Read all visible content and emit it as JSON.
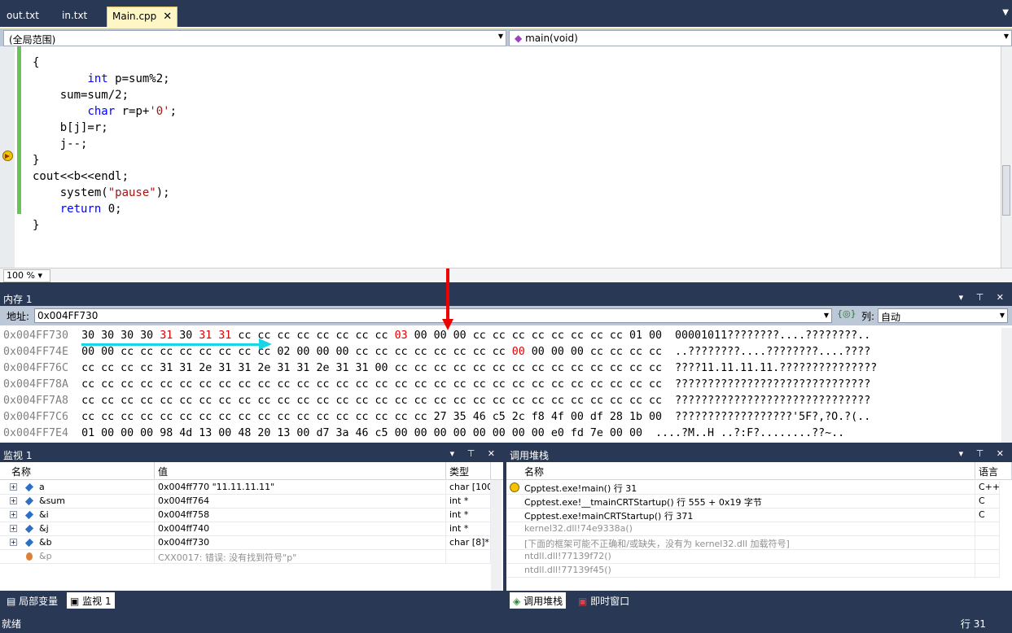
{
  "tabs": [
    {
      "label": "out.txt",
      "active": false
    },
    {
      "label": "in.txt",
      "active": false
    },
    {
      "label": "Main.cpp",
      "active": true
    }
  ],
  "nav": {
    "scope": "(全局范围)",
    "function": "main(void)"
  },
  "code": [
    "{",
    "    int p=sum%2;",
    "    sum=sum/2;",
    "    char r=p+'0';",
    "    b[j]=r;",
    "    j--;",
    "}",
    "cout<<b<<endl;",
    "system(\"pause\");",
    "return 0;",
    "}"
  ],
  "zoom": "100 %",
  "memory": {
    "title": "内存 1",
    "addr_label": "地址:",
    "address": "0x004FF730",
    "col_label": "列:",
    "col_value": "自动",
    "rows": [
      {
        "addr": "0x004FF730",
        "hex": "30 30 30 30 31 30 31 31 cc cc cc cc cc cc cc cc 03 00 00 00 cc cc cc cc cc cc cc cc 01 00",
        "ascii": "00001011????????....????????.."
      },
      {
        "addr": "0x004FF74E",
        "hex": "00 00 cc cc cc cc cc cc cc cc 02 00 00 00 cc cc cc cc cc cc cc cc 00 00 00 00 cc cc cc cc",
        "ascii": "..????????....????????....????"
      },
      {
        "addr": "0x004FF76C",
        "hex": "cc cc cc cc 31 31 2e 31 31 2e 31 31 2e 31 31 00 cc cc cc cc cc cc cc cc cc cc cc cc cc cc",
        "ascii": "????11.11.11.11.???????????????"
      },
      {
        "addr": "0x004FF78A",
        "hex": "cc cc cc cc cc cc cc cc cc cc cc cc cc cc cc cc cc cc cc cc cc cc cc cc cc cc cc cc cc cc",
        "ascii": "??????????????????????????????"
      },
      {
        "addr": "0x004FF7A8",
        "hex": "cc cc cc cc cc cc cc cc cc cc cc cc cc cc cc cc cc cc cc cc cc cc cc cc cc cc cc cc cc cc",
        "ascii": "??????????????????????????????"
      },
      {
        "addr": "0x004FF7C6",
        "hex": "cc cc cc cc cc cc cc cc cc cc cc cc cc cc cc cc cc cc 27 35 46 c5 2c f8 4f 00 df 28 1b 00",
        "ascii": "??????????????????'5F?,?O.?(.."
      },
      {
        "addr": "0x004FF7E4",
        "hex": "01 00 00 00 98 4d 13 00 48 20 13 00 d7 3a 46 c5 00 00 00 00 00 00 00 00 e0 fd 7e 00 00",
        "ascii": "....?M..H ..?:F?........??~.."
      }
    ]
  },
  "watch": {
    "title": "监视 1",
    "headers": [
      "名称",
      "值",
      "类型"
    ],
    "rows": [
      {
        "name": "a",
        "value": "0x004ff770 \"11.11.11.11\"",
        "type": "char [100"
      },
      {
        "name": "&sum",
        "value": "0x004ff764",
        "type": "int *"
      },
      {
        "name": "&i",
        "value": "0x004ff758",
        "type": "int *"
      },
      {
        "name": "&j",
        "value": "0x004ff740",
        "type": "int *"
      },
      {
        "name": "&b",
        "value": "0x004ff730",
        "type": "char [8]*"
      },
      {
        "name": "&p",
        "value": "CXX0017: 错误: 没有找到符号\"p\"",
        "type": ""
      }
    ]
  },
  "callstack": {
    "title": "调用堆栈",
    "headers": [
      "名称",
      "语言"
    ],
    "rows": [
      {
        "name": "Cpptest.exe!main()  行 31",
        "lang": "C++"
      },
      {
        "name": "Cpptest.exe!__tmainCRTStartup()  行 555 + 0x19 字节",
        "lang": "C"
      },
      {
        "name": "Cpptest.exe!mainCRTStartup()  行 371",
        "lang": "C"
      },
      {
        "name": "kernel32.dll!74e9338a()",
        "lang": ""
      },
      {
        "name": "[下面的框架可能不正确和/或缺失，没有为 kernel32.dll 加载符号]",
        "lang": ""
      },
      {
        "name": "ntdll.dll!77139f72()",
        "lang": ""
      },
      {
        "name": "ntdll.dll!77139f45()",
        "lang": ""
      }
    ]
  },
  "bottom_tabs": {
    "locals": "局部变量",
    "watch": "监视 1",
    "callstack": "调用堆栈",
    "immediate": "即时窗口"
  },
  "status": {
    "text": "就绪",
    "line": "行 31"
  }
}
